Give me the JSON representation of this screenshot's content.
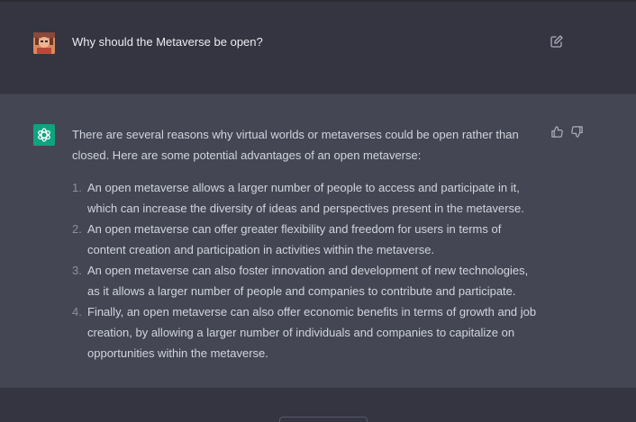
{
  "user_message": {
    "text": "Why should the Metaverse be open?"
  },
  "assistant_message": {
    "intro": "There are several reasons why virtual worlds or metaverses could be open rather than closed. Here are some potential advantages of an open metaverse:",
    "points": [
      {
        "number": "1.",
        "text": "An open metaverse allows a larger number of people to access and participate in it, which can increase the diversity of ideas and perspectives present in the metaverse."
      },
      {
        "number": "2.",
        "text": "An open metaverse can offer greater flexibility and freedom for users in terms of content creation and participation in activities within the metaverse."
      },
      {
        "number": "3.",
        "text": "An open metaverse can also foster innovation and development of new technologies, as it allows a larger number of people and companies to contribute and participate."
      },
      {
        "number": "4.",
        "text": "Finally, an open metaverse can also offer economic benefits in terms of growth and job creation, by allowing a larger number of individuals and companies to capitalize on opportunities within the metaverse."
      }
    ]
  },
  "icons": {
    "user_avatar": "user-avatar",
    "bot_avatar": "openai-logo-icon",
    "edit": "edit-icon",
    "thumbs_up": "thumbs-up-icon",
    "thumbs_down": "thumbs-down-icon"
  },
  "colors": {
    "background": "#343541",
    "assistant_background": "#444654",
    "text": "#d1d5db",
    "bot_avatar": "#10a37f"
  }
}
